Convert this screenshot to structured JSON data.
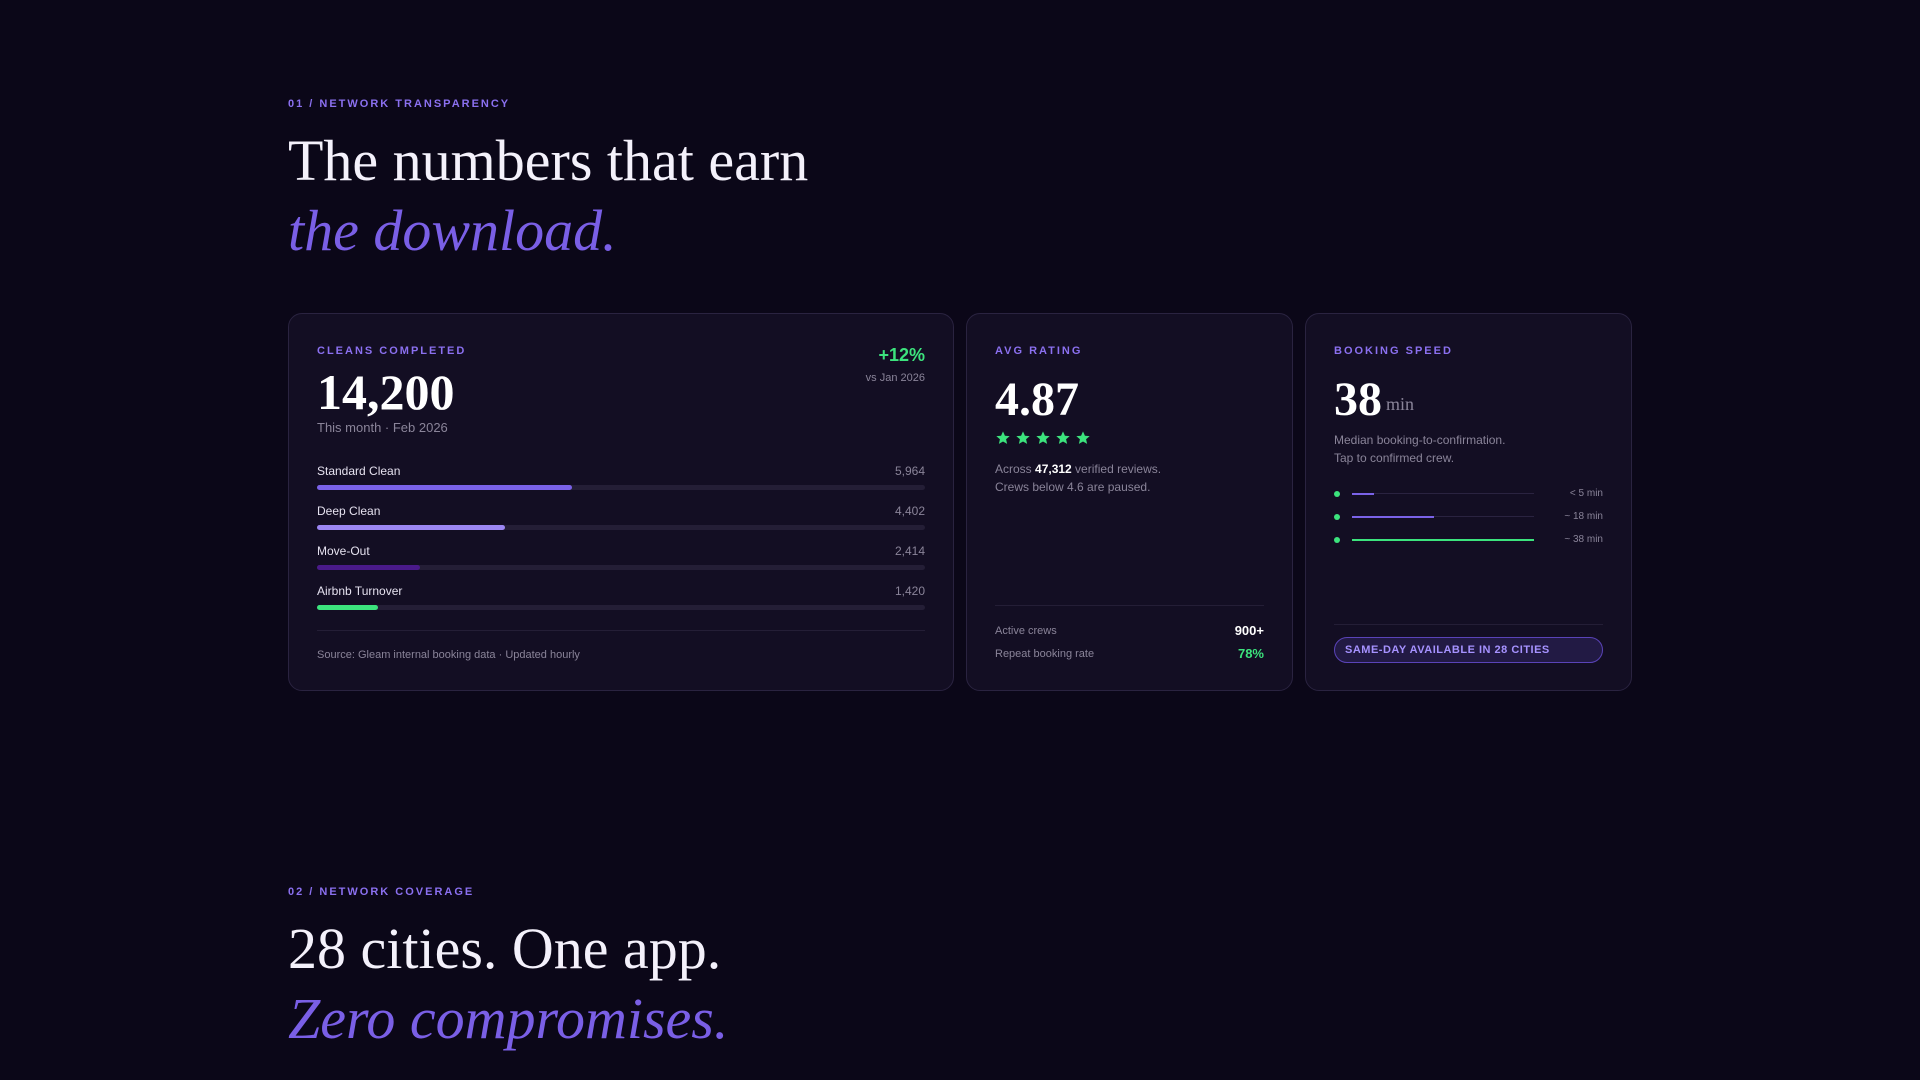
{
  "section1": {
    "eyebrow": "01 / NETWORK TRANSPARENCY",
    "headline_line1": "The numbers that earn",
    "headline_line2": "the download."
  },
  "cleans_card": {
    "label": "CLEANS COMPLETED",
    "value": "14,200",
    "subtitle": "This month · Feb 2026",
    "delta": "+12%",
    "delta_ref": "vs Jan 2026",
    "bars": [
      {
        "name": "Standard Clean",
        "value": "5,964",
        "fraction": 0.42,
        "color": "#7a62e8"
      },
      {
        "name": "Deep Clean",
        "value": "4,402",
        "fraction": 0.31,
        "color": "#9b86f2"
      },
      {
        "name": "Move-Out",
        "value": "2,414",
        "fraction": 0.17,
        "color": "#4a1a8a"
      },
      {
        "name": "Airbnb Turnover",
        "value": "1,420",
        "fraction": 0.1,
        "color": "#3ce37d"
      }
    ],
    "source": "Source: Gleam internal booking data · Updated hourly"
  },
  "rating_card": {
    "label": "AVG RATING",
    "value": "4.87",
    "stars": 5,
    "star_color": "#3ce37d",
    "reviews_prefix": "Across ",
    "reviews_count": "47,312",
    "reviews_suffix": " verified reviews.",
    "paused_note": "Crews below 4.6 are paused.",
    "stats": [
      {
        "label": "Active crews",
        "value": "900+",
        "color": "#ffffff"
      },
      {
        "label": "Repeat booking rate",
        "value": "78%",
        "color": "#3ce37d"
      }
    ]
  },
  "speed_card": {
    "label": "BOOKING SPEED",
    "value": "38",
    "unit": "min",
    "desc_line1": "Median booking-to-confirmation.",
    "desc_line2": "Tap to confirmed crew.",
    "rows": [
      {
        "label": "< 5 min",
        "fraction": 0.12,
        "color": "#7a62e8"
      },
      {
        "label": "~ 18 min",
        "fraction": 0.45,
        "color": "#7a62e8"
      },
      {
        "label": "~ 38 min",
        "fraction": 1.0,
        "color": "#3ce37d"
      }
    ],
    "badge": "SAME-DAY AVAILABLE IN 28 CITIES"
  },
  "section2": {
    "eyebrow": "02 / NETWORK COVERAGE",
    "headline_line1": "28 cities. One app.",
    "headline_line2": "Zero compromises."
  }
}
